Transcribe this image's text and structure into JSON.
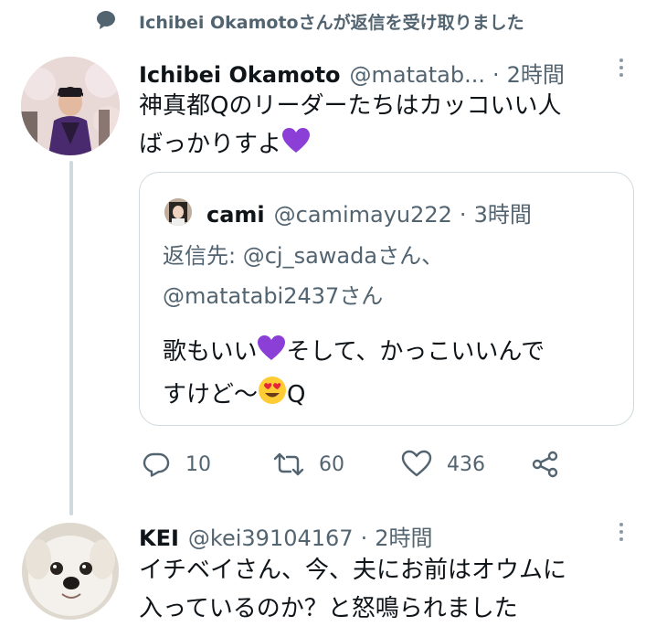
{
  "context": {
    "icon": "speech-bubble-icon",
    "text": "Ichibei Okamotoさんが返信を受け取りました"
  },
  "tweet": {
    "display_name": "Ichibei Okamoto",
    "handle": "@matatab...",
    "separator": "·",
    "time": "2時間",
    "text_line1": "神真都Qのリーダーたちはカッコいい人",
    "text_line2": "ばっかりすよ",
    "emoji": "purple-heart"
  },
  "quote": {
    "display_name": "cami",
    "handle": "@camimayu222",
    "separator": "·",
    "time": "3時間",
    "reply_prefix": "返信先: ",
    "reply_mention1": "@cj_sawada",
    "reply_suffix1": "さん、",
    "reply_mention2": "@matatabi2437",
    "reply_suffix2": "さん",
    "text_part1": "歌もいい",
    "text_part2": "そして、かっこいいんで",
    "text_line2_part1": "すけど〜",
    "text_line2_part2": "Q"
  },
  "actions": {
    "replies": "10",
    "retweets": "60",
    "likes": "436"
  },
  "reply": {
    "display_name": "KEI",
    "handle": "@kei39104167",
    "separator": "·",
    "time": "2時間",
    "text_line1": "イチベイさん、今、夫にお前はオウムに",
    "text_line2": "入っているのか？と怒鳴られました"
  },
  "colors": {
    "muted": "#536471",
    "border": "#cfd9de",
    "heart": "#8b3fd6"
  }
}
